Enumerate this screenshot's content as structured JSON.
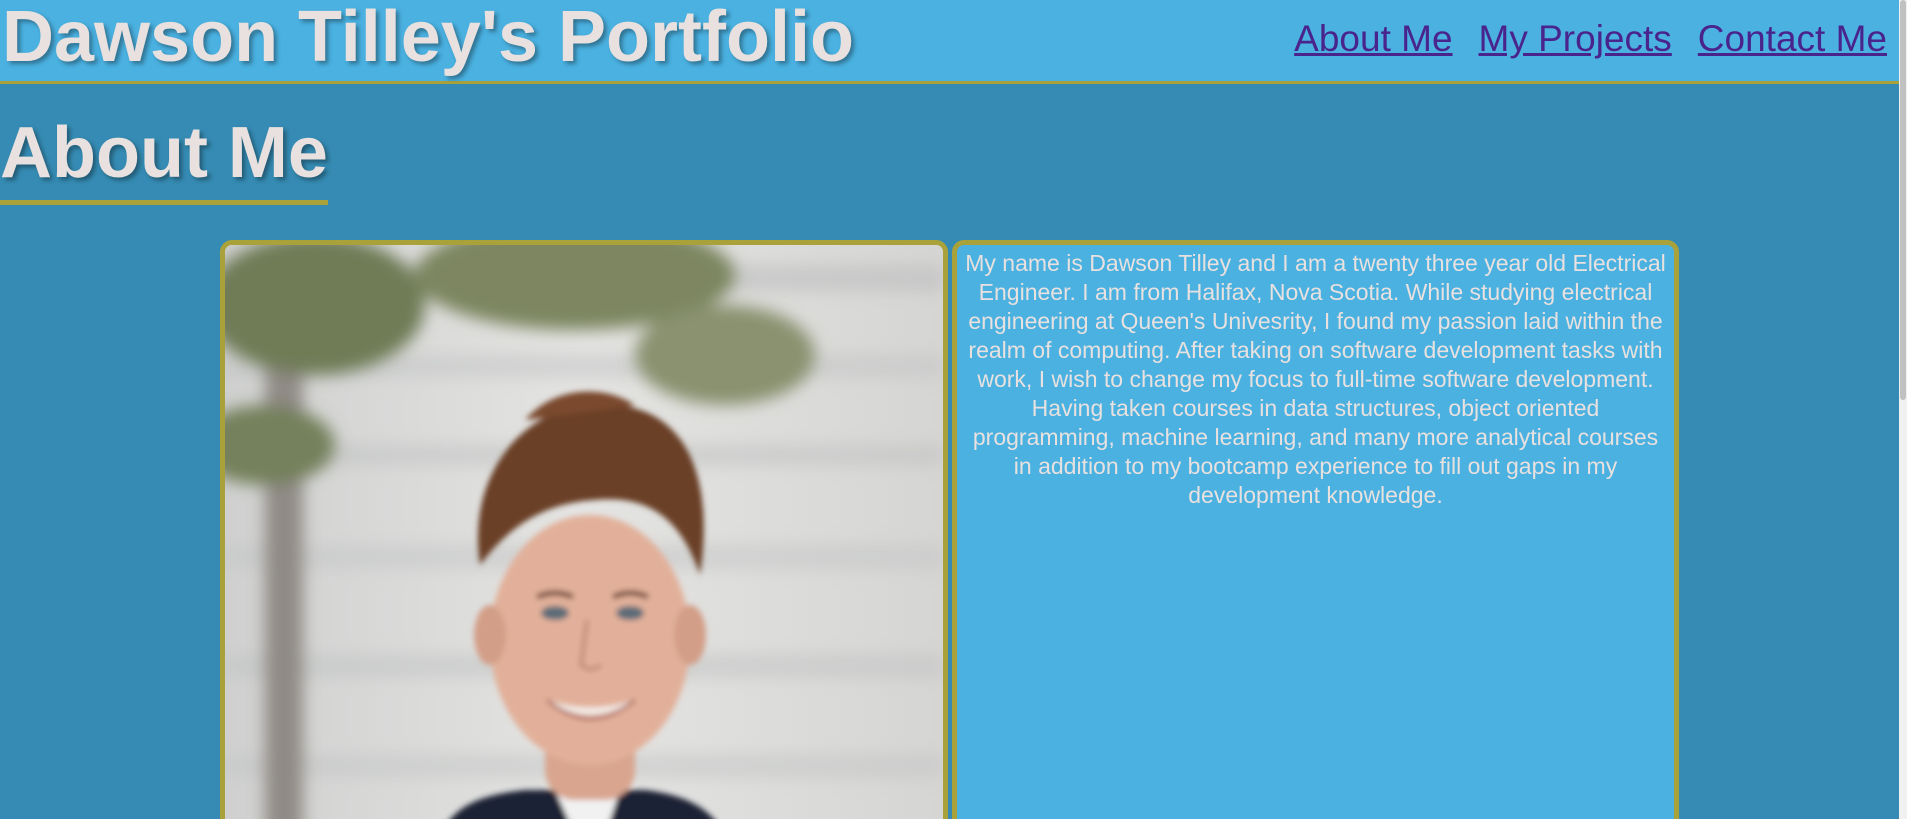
{
  "header": {
    "title": "Dawson Tilley's Portfolio",
    "nav": [
      {
        "label": "About Me"
      },
      {
        "label": "My Projects"
      },
      {
        "label": "Contact Me"
      }
    ]
  },
  "main": {
    "section_title": "About Me",
    "photo": {
      "icon": "portrait-photo"
    },
    "bio": "My name is Dawson Tilley and I am a twenty three year old Electrical Engineer. I am from Halifax, Nova Scotia. While studying electrical engineering at Queen's Univesrity, I found my passion laid within the realm of computing. After taking on software development tasks with work, I wish to change my focus to full-time software development. Having taken courses in data structures, object oriented programming, machine learning, and many more analytical courses in addition to my bootcamp experience to fill out gaps in my development knowledge."
  },
  "colors": {
    "page_background": "#358bb3",
    "header_background": "#4ab1e1",
    "accent_border": "#a9a23a",
    "heading_text": "#e8e1df",
    "link_text": "#4a248d"
  }
}
